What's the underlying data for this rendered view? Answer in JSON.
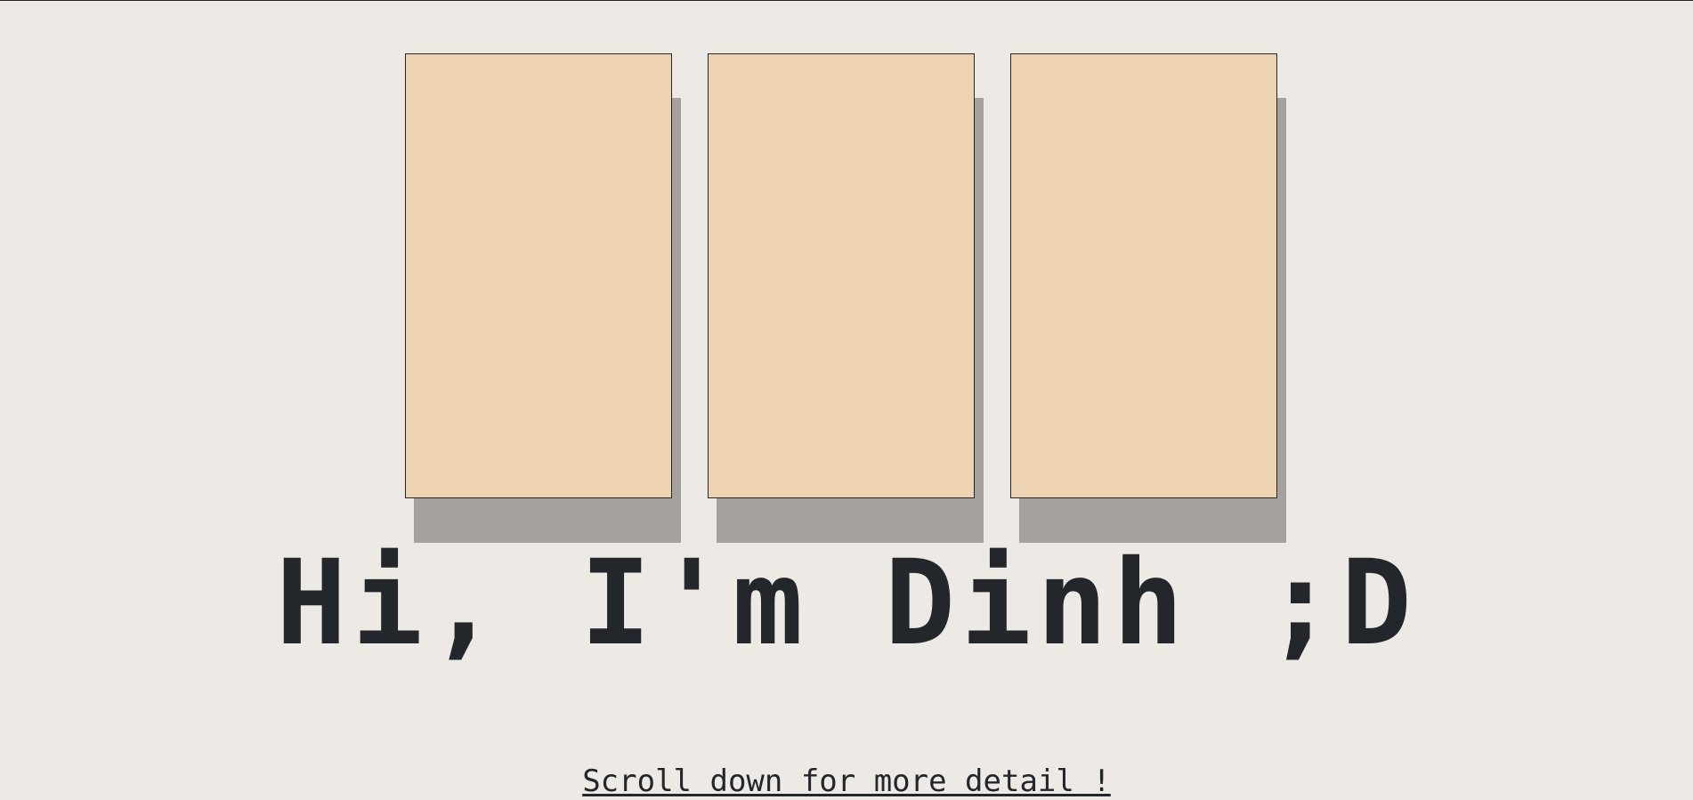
{
  "hero": {
    "greeting": "Hi, I'm Dinh ;D",
    "scroll_hint": "Scroll down for more detail !"
  },
  "colors": {
    "background": "#ede9e4",
    "card": "#eed3b2",
    "card_shadow": "#a5a29d",
    "ink": "#23262b"
  }
}
